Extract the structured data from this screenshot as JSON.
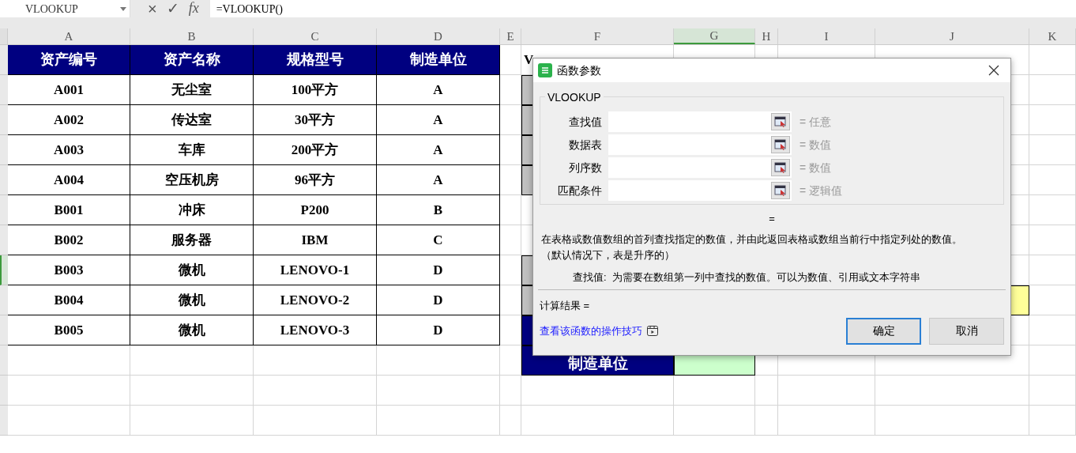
{
  "formula_bar": {
    "name_box": "VLOOKUP",
    "cancel_icon": "×",
    "confirm_icon": "✓",
    "fx_label": "fx",
    "formula": "=VLOOKUP()"
  },
  "columns": [
    {
      "label": "A",
      "selected": false
    },
    {
      "label": "B",
      "selected": false
    },
    {
      "label": "C",
      "selected": false
    },
    {
      "label": "D",
      "selected": false
    },
    {
      "label": "E",
      "selected": false
    },
    {
      "label": "F",
      "selected": false
    },
    {
      "label": "G",
      "selected": true
    },
    {
      "label": "H",
      "selected": false
    },
    {
      "label": "I",
      "selected": false
    },
    {
      "label": "J",
      "selected": false
    },
    {
      "label": "K",
      "selected": false
    }
  ],
  "row_headers": [
    {
      "selected": false
    },
    {
      "selected": false
    },
    {
      "selected": false
    },
    {
      "selected": false
    },
    {
      "selected": false
    },
    {
      "selected": false
    },
    {
      "selected": false
    },
    {
      "selected": true
    },
    {
      "selected": false
    },
    {
      "selected": false
    },
    {
      "selected": false
    },
    {
      "selected": false
    },
    {
      "selected": false
    }
  ],
  "table": {
    "header": [
      "资产编号",
      "资产名称",
      "规格型号",
      "制造单位"
    ],
    "rows": [
      [
        "A001",
        "无尘室",
        "100平方",
        "A"
      ],
      [
        "A002",
        "传达室",
        "30平方",
        "A"
      ],
      [
        "A003",
        "车库",
        "200平方",
        "A"
      ],
      [
        "A004",
        "空压机房",
        "96平方",
        "A"
      ],
      [
        "B001",
        "冲床",
        "P200",
        "B"
      ],
      [
        "B002",
        "服务器",
        "IBM",
        "C"
      ],
      [
        "B003",
        "微机",
        "LENOVO-1",
        "D"
      ],
      [
        "B004",
        "微机",
        "LENOVO-2",
        "D"
      ],
      [
        "B005",
        "微机",
        "LENOVO-3",
        "D"
      ]
    ]
  },
  "side": {
    "title": "V",
    "label": "制造单位"
  },
  "dialog": {
    "title": "函数参数",
    "function_name": "VLOOKUP",
    "params": [
      {
        "label": "查找值",
        "hint": "= 任意"
      },
      {
        "label": "数据表",
        "hint": "= 数值"
      },
      {
        "label": "列序数",
        "hint": "= 数值"
      },
      {
        "label": "匹配条件",
        "hint": "= 逻辑值"
      }
    ],
    "result_eq": "=",
    "description": "在表格或数值数组的首列查找指定的数值，并由此返回表格或数组当前行中指定列处的数值。（默认情况下，表是升序的）",
    "param_help": "查找值:  为需要在数组第一列中查找的数值。可以为数值、引用或文本字符串",
    "calc_result": "计算结果 =",
    "link": "查看该函数的操作技巧",
    "buttons": [
      {
        "label": "确定",
        "focused": true
      },
      {
        "label": "取消",
        "focused": false
      }
    ]
  }
}
